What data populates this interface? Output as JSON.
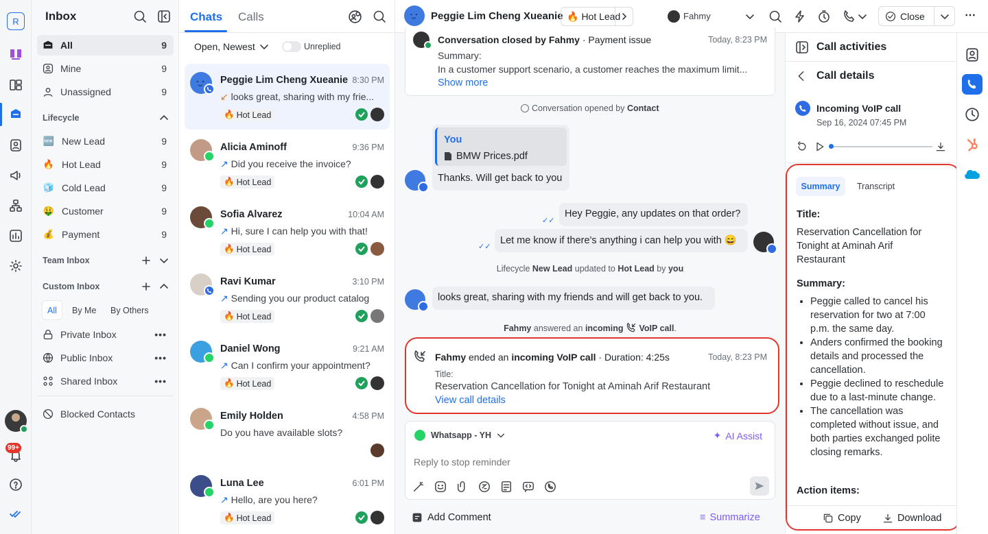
{
  "rail": {
    "workspace_initial": "R",
    "notification_count": "99+"
  },
  "inbox": {
    "title": "Inbox",
    "items": [
      {
        "label": "All",
        "count": "9"
      },
      {
        "label": "Mine",
        "count": "9"
      },
      {
        "label": "Unassigned",
        "count": "9"
      }
    ],
    "lifecycle_header": "Lifecycle",
    "lifecycle": [
      {
        "emoji": "🆕",
        "label": "New Lead",
        "count": "9"
      },
      {
        "emoji": "🔥",
        "label": "Hot Lead",
        "count": "9"
      },
      {
        "emoji": "🧊",
        "label": "Cold Lead",
        "count": "9"
      },
      {
        "emoji": "🤑",
        "label": "Customer",
        "count": "9"
      },
      {
        "emoji": "💰",
        "label": "Payment",
        "count": "9"
      }
    ],
    "team_inbox_header": "Team Inbox",
    "custom_inbox_header": "Custom Inbox",
    "filters": [
      "All",
      "By Me",
      "By Others"
    ],
    "custom": [
      {
        "label": "Private Inbox"
      },
      {
        "label": "Public Inbox"
      },
      {
        "label": "Shared Inbox"
      }
    ],
    "blocked": "Blocked Contacts"
  },
  "chats": {
    "tabs": [
      "Chats",
      "Calls"
    ],
    "sort_label": "Open, Newest",
    "unreplied_label": "Unreplied",
    "items": [
      {
        "name": "Peggie Lim Cheng Xueanie",
        "time": "8:30 PM",
        "preview": "looks great, sharing with my frie...",
        "tag": "Hot Lead"
      },
      {
        "name": "Alicia Aminoff",
        "time": "9:36 PM",
        "preview": "Did you receive the invoice?",
        "tag": "Hot Lead"
      },
      {
        "name": "Sofia Alvarez",
        "time": "10:04 AM",
        "preview": "Hi, sure I can help you with that!",
        "tag": "Hot Lead"
      },
      {
        "name": "Ravi Kumar",
        "time": "3:10 PM",
        "preview": "Sending you our product catalog",
        "tag": "Hot Lead"
      },
      {
        "name": "Daniel Wong",
        "time": "9:21 AM",
        "preview": "Can I confirm your appointment?",
        "tag": "Hot Lead"
      },
      {
        "name": "Emily Holden",
        "time": "4:58 PM",
        "preview": "Do you have available slots?",
        "tag": ""
      },
      {
        "name": "Luna Lee",
        "time": "6:01 PM",
        "preview": "Hello, are you here?",
        "tag": "Hot Lead"
      }
    ]
  },
  "header": {
    "contact_name": "Peggie Lim Cheng Xueanie",
    "lifecycle_tag": "Hot Lead",
    "assignee": "Fahmy",
    "close_label": "Close"
  },
  "conversation": {
    "closed_card": {
      "title_bold": "Conversation closed by Fahmy",
      "title_rest": " · Payment issue",
      "time": "Today, 8:23 PM",
      "summary_label": "Summary:",
      "summary_text": "In a customer support scenario, a customer reaches the maximum limit...",
      "show_more": "Show more"
    },
    "opened_sys": {
      "text": "Conversation opened by",
      "actor": "Contact"
    },
    "quote_author": "You",
    "quote_file": "BMW Prices.pdf",
    "msg1": "Thanks. Will get back to you",
    "msg2": "Hey Peggie, any updates on that order?",
    "msg3": "Let me know if there's anything i can help you with 😄",
    "lifecycle_sys": {
      "a": "Lifecycle",
      "b": "New Lead",
      "c": "updated to",
      "d": "Hot Lead",
      "e": "by",
      "f": "you"
    },
    "msg4": "looks great, sharing with my friends and will get back to you.",
    "voip_sys": {
      "a": "Fahmy",
      "b": "answered an",
      "c": "incoming",
      "d": "VoIP call",
      "e": "."
    },
    "call_card": {
      "actor": "Fahmy",
      "text1": "ended an",
      "call_type": "incoming VoIP call",
      "duration": "· Duration: 4:25s",
      "time": "Today, 8:23 PM",
      "title_label": "Title:",
      "title_value": "Reservation Cancellation for Tonight at Aminah Arif Restaurant",
      "link": "View call details"
    }
  },
  "composer": {
    "channel": "Whatsapp - YH",
    "ai_assist": "AI Assist",
    "placeholder": "Reply to stop reminder",
    "add_comment": "Add Comment",
    "summarize": "Summarize"
  },
  "right_panel": {
    "title": "Call activities",
    "details_title": "Call details",
    "call_type": "Incoming VoIP call",
    "call_date": "Sep 16, 2024 07:45 PM",
    "tabs": [
      "Summary",
      "Transcript"
    ],
    "title_label": "Title:",
    "title_value": "Reservation Cancellation for Tonight at Aminah Arif Restaurant",
    "summary_label": "Summary:",
    "bullets": [
      "Peggie called to cancel his reservation for two at 7:00 p.m. the same day.",
      "Anders confirmed the booking details and processed the cancellation.",
      "Peggie declined to reschedule due to a last-minute change.",
      "The cancellation was completed without issue, and both parties exchanged polite closing remarks."
    ],
    "action_label": "Action items:",
    "copy": "Copy",
    "download": "Download"
  },
  "colors": {
    "accent": "#1f6feb",
    "highlight_border": "#e0362b",
    "success": "#1fa15c",
    "ai_purple": "#7b5cf5"
  }
}
